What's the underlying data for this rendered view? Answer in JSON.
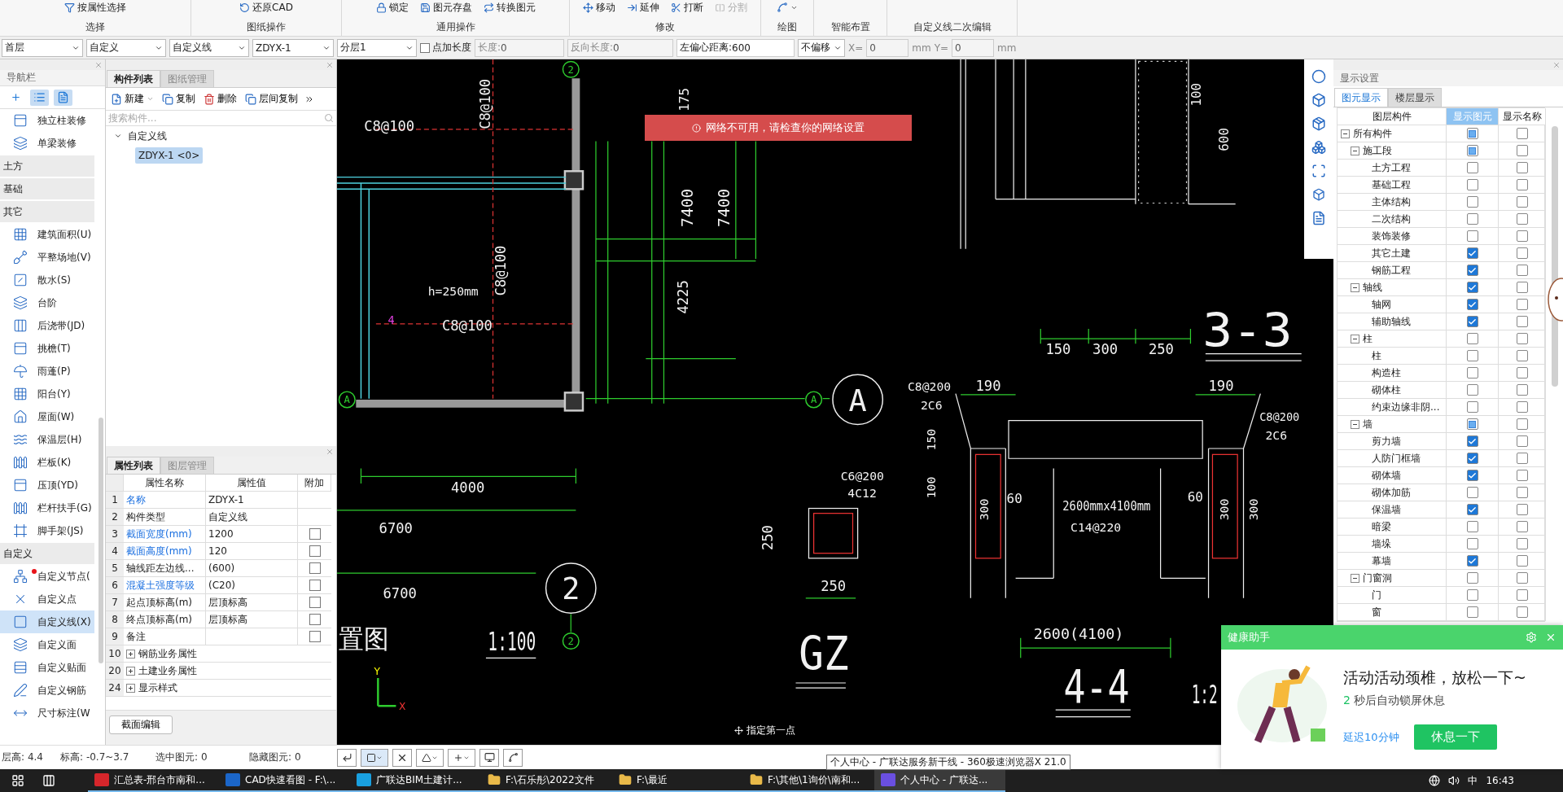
{
  "ribbon": {
    "groups": [
      {
        "label": "选择",
        "buttons": [
          {
            "label": "按属性选择",
            "disabled": false
          }
        ]
      },
      {
        "label": "图纸操作",
        "buttons": [
          {
            "label": "还原CAD",
            "disabled": false
          }
        ]
      },
      {
        "label": "通用操作",
        "buttons": [
          {
            "label": "锁定",
            "disabled": false
          },
          {
            "label": "图元存盘",
            "disabled": false
          },
          {
            "label": "转换图元",
            "disabled": false
          }
        ]
      },
      {
        "label": "修改",
        "buttons": [
          {
            "label": "移动",
            "disabled": false
          },
          {
            "label": "延伸",
            "disabled": false
          },
          {
            "label": "打断",
            "disabled": false
          },
          {
            "label": "分割",
            "disabled": true
          }
        ]
      },
      {
        "label": "绘图"
      },
      {
        "label": "智能布置"
      },
      {
        "label": "自定义线二次编辑"
      }
    ]
  },
  "toolbar": {
    "floor": "首层",
    "category": "自定义",
    "type": "自定义线",
    "component": "ZDYX-1",
    "layer": "分层1",
    "add_length": {
      "label": "点加长度",
      "checked": false
    },
    "length": {
      "label": "长度:",
      "value": "0"
    },
    "reverse_length": {
      "label": "反向长度:",
      "value": "0"
    },
    "left_offset": {
      "label": "左偏心距离:",
      "value": "600"
    },
    "offset_mode": "不偏移",
    "x": {
      "label": "X=",
      "value": "0",
      "unit": "mm"
    },
    "y": {
      "label": "Y=",
      "value": "0",
      "unit": "mm"
    }
  },
  "nav": {
    "title": "导航栏",
    "items": [
      {
        "kind": "item",
        "label": "独立柱装修",
        "selected": false,
        "alert": false
      },
      {
        "kind": "item",
        "label": "单梁装修",
        "selected": false,
        "alert": false
      },
      {
        "kind": "group",
        "label": "土方"
      },
      {
        "kind": "group",
        "label": "基础"
      },
      {
        "kind": "group",
        "label": "其它"
      },
      {
        "kind": "item",
        "label": "建筑面积(U)",
        "selected": false,
        "alert": false
      },
      {
        "kind": "item",
        "label": "平整场地(V)",
        "selected": false,
        "alert": false
      },
      {
        "kind": "item",
        "label": "散水(S)",
        "selected": false,
        "alert": false
      },
      {
        "kind": "item",
        "label": "台阶",
        "selected": false,
        "alert": false
      },
      {
        "kind": "item",
        "label": "后浇带(JD)",
        "selected": false,
        "alert": false
      },
      {
        "kind": "item",
        "label": "挑檐(T)",
        "selected": false,
        "alert": false
      },
      {
        "kind": "item",
        "label": "雨蓬(P)",
        "selected": false,
        "alert": false
      },
      {
        "kind": "item",
        "label": "阳台(Y)",
        "selected": false,
        "alert": false
      },
      {
        "kind": "item",
        "label": "屋面(W)",
        "selected": false,
        "alert": false
      },
      {
        "kind": "item",
        "label": "保温层(H)",
        "selected": false,
        "alert": false
      },
      {
        "kind": "item",
        "label": "栏板(K)",
        "selected": false,
        "alert": false
      },
      {
        "kind": "item",
        "label": "压顶(YD)",
        "selected": false,
        "alert": false
      },
      {
        "kind": "item",
        "label": "栏杆扶手(G)",
        "selected": false,
        "alert": false
      },
      {
        "kind": "item",
        "label": "脚手架(JS)",
        "selected": false,
        "alert": false
      },
      {
        "kind": "group",
        "label": "自定义"
      },
      {
        "kind": "item",
        "label": "自定义节点(",
        "selected": false,
        "alert": true
      },
      {
        "kind": "item",
        "label": "自定义点",
        "selected": false,
        "alert": false
      },
      {
        "kind": "item",
        "label": "自定义线(X)",
        "selected": true,
        "alert": false
      },
      {
        "kind": "item",
        "label": "自定义面",
        "selected": false,
        "alert": false
      },
      {
        "kind": "item",
        "label": "自定义贴面",
        "selected": false,
        "alert": false
      },
      {
        "kind": "item",
        "label": "自定义钢筋",
        "selected": false,
        "alert": false
      },
      {
        "kind": "item",
        "label": "尺寸标注(W",
        "selected": false,
        "alert": false
      }
    ]
  },
  "components_panel": {
    "tabs": [
      {
        "label": "构件列表",
        "selected": true
      },
      {
        "label": "图纸管理",
        "selected": false
      }
    ],
    "actions": [
      "新建",
      "复制",
      "删除",
      "层间复制"
    ],
    "search_placeholder": "搜索构件...",
    "tree": [
      {
        "label": "自定义线",
        "expanded": true,
        "children": [
          {
            "label": "ZDYX-1 <0>",
            "selected": true
          }
        ]
      }
    ]
  },
  "properties": {
    "tabs": [
      {
        "label": "属性列表",
        "selected": true
      },
      {
        "label": "图层管理",
        "selected": false
      }
    ],
    "columns": [
      "属性名称",
      "属性值",
      "附加"
    ],
    "rows": [
      {
        "kind": "plain",
        "num": "1",
        "name": "名称",
        "highlighted": true,
        "value": "ZDYX-1"
      },
      {
        "kind": "plain",
        "num": "2",
        "name": "构件类型",
        "highlighted": false,
        "value": "自定义线"
      },
      {
        "kind": "check",
        "num": "3",
        "name": "截面宽度(mm)",
        "highlighted": true,
        "value": "1200",
        "checked": false
      },
      {
        "kind": "check",
        "num": "4",
        "name": "截面高度(mm)",
        "highlighted": true,
        "value": "120",
        "checked": false
      },
      {
        "kind": "check",
        "num": "5",
        "name": "轴线距左边线...",
        "highlighted": false,
        "value": "(600)",
        "checked": false
      },
      {
        "kind": "check",
        "num": "6",
        "name": "混凝土强度等级",
        "highlighted": true,
        "value": "(C20)",
        "checked": false
      },
      {
        "kind": "check",
        "num": "7",
        "name": "起点顶标高(m)",
        "highlighted": false,
        "value": "层顶标高",
        "checked": false
      },
      {
        "kind": "check",
        "num": "8",
        "name": "终点顶标高(m)",
        "highlighted": false,
        "value": "层顶标高",
        "checked": false
      },
      {
        "kind": "check",
        "num": "9",
        "name": "备注",
        "highlighted": false,
        "checked": false
      },
      {
        "kind": "group",
        "num": "10",
        "name": "钢筋业务属性",
        "expanded": false
      },
      {
        "kind": "group",
        "num": "20",
        "name": "土建业务属性",
        "expanded": false
      },
      {
        "kind": "group",
        "num": "24",
        "name": "显示样式",
        "expanded": false
      }
    ],
    "button": "截面编辑"
  },
  "canvas": {
    "notice": "网络不可用，请检查你的网络设置",
    "prompt": "指定第一点",
    "labels": [
      "C8@100",
      "C8@100",
      "h=250mm",
      "C8@100",
      "4",
      "C8@100",
      "4000",
      "6700",
      "6700",
      "置图",
      "1:100",
      "175",
      "7400",
      "7400",
      "4225",
      "GZ",
      "C6@200",
      "4C12",
      "250",
      "250",
      "C8@200",
      "2C6",
      "190",
      "150",
      "100",
      "300",
      "60",
      "2600mmx4100mm",
      "C14@220",
      "2600(4100)",
      "4-4",
      "1:2",
      "190",
      "C8@200",
      "2C6",
      "60",
      "300",
      "300",
      "3-3",
      "150",
      "300",
      "250",
      "100",
      "600"
    ],
    "axis_bubbles": [
      "2",
      "A",
      "A",
      "A",
      "2",
      "2"
    ],
    "axis_triad": {
      "x": "X",
      "y": "Y"
    }
  },
  "display_settings": {
    "title": "显示设置",
    "tabs": [
      {
        "label": "图元显示",
        "selected": true
      },
      {
        "label": "楼层显示",
        "selected": false
      }
    ],
    "columns": [
      "图层构件",
      "显示图元",
      "显示名称"
    ],
    "tree": [
      {
        "label": "所有构件",
        "shown": false,
        "mixed": true,
        "show_name": false,
        "expanded": true,
        "children": [
          {
            "label": "施工段",
            "shown": false,
            "mixed": true,
            "show_name": false,
            "expanded": true,
            "children": [
              {
                "label": "土方工程",
                "shown": false,
                "mixed": false,
                "show_name": false
              },
              {
                "label": "基础工程",
                "shown": false,
                "mixed": false,
                "show_name": false
              },
              {
                "label": "主体结构",
                "shown": false,
                "mixed": false,
                "show_name": false
              },
              {
                "label": "二次结构",
                "shown": false,
                "mixed": false,
                "show_name": false
              },
              {
                "label": "装饰装修",
                "shown": false,
                "mixed": false,
                "show_name": false
              },
              {
                "label": "其它土建",
                "shown": true,
                "show_name": false
              },
              {
                "label": "钢筋工程",
                "shown": true,
                "show_name": false
              }
            ]
          },
          {
            "label": "轴线",
            "shown": true,
            "show_name": false,
            "expanded": true,
            "children": [
              {
                "label": "轴网",
                "shown": true,
                "show_name": false
              },
              {
                "label": "辅助轴线",
                "shown": true,
                "show_name": false
              }
            ]
          },
          {
            "label": "柱",
            "shown": false,
            "mixed": false,
            "show_name": false,
            "expanded": true,
            "children": [
              {
                "label": "柱",
                "shown": false,
                "mixed": false,
                "show_name": false
              },
              {
                "label": "构造柱",
                "shown": false,
                "mixed": false,
                "show_name": false
              },
              {
                "label": "砌体柱",
                "shown": false,
                "mixed": false,
                "show_name": false
              },
              {
                "label": "约束边缘非阴...",
                "shown": false,
                "mixed": false,
                "show_name": false
              }
            ]
          },
          {
            "label": "墙",
            "shown": false,
            "mixed": true,
            "show_name": false,
            "expanded": true,
            "children": [
              {
                "label": "剪力墙",
                "shown": true,
                "show_name": false
              },
              {
                "label": "人防门框墙",
                "shown": true,
                "show_name": false
              },
              {
                "label": "砌体墙",
                "shown": true,
                "show_name": false
              },
              {
                "label": "砌体加筋",
                "shown": false,
                "mixed": false,
                "show_name": false
              },
              {
                "label": "保温墙",
                "shown": true,
                "show_name": false
              },
              {
                "label": "暗梁",
                "shown": false,
                "mixed": false,
                "show_name": false
              },
              {
                "label": "墙垛",
                "shown": false,
                "mixed": false,
                "show_name": false
              },
              {
                "label": "幕墙",
                "shown": true,
                "show_name": false
              }
            ]
          },
          {
            "label": "门窗洞",
            "shown": false,
            "mixed": false,
            "show_name": false,
            "expanded": true,
            "children": [
              {
                "label": "门",
                "shown": false,
                "mixed": false,
                "show_name": false
              },
              {
                "label": "窗",
                "shown": false,
                "mixed": false,
                "show_name": false
              }
            ]
          }
        ]
      }
    ]
  },
  "status": [
    {
      "label": "层高:",
      "value": "4.4"
    },
    {
      "label": "标高:",
      "value": "-0.7~3.7"
    },
    {
      "label": "选中图元:",
      "value": "0"
    },
    {
      "label": "隐藏图元:",
      "value": "0"
    }
  ],
  "health_popup": {
    "title": "健康助手",
    "message": "活动活动颈椎，放松一下~",
    "countdown": "2",
    "countdown_text": "秒后自动锁屏休息",
    "delay_link": "延迟10分钟",
    "rest_button": "休息一下"
  },
  "tooltip": "个人中心 - 广联达服务新干线 - 360极速浏览器X 21.0",
  "taskbar": {
    "apps": [
      {
        "kind": "wps",
        "label": "汇总表-邢台市南和...",
        "active": false
      },
      {
        "kind": "cad",
        "label": "CAD快速看图 - F:\\...",
        "active": false
      },
      {
        "kind": "bim",
        "label": "广联达BIM土建计...",
        "active": false
      },
      {
        "kind": "folder",
        "label": "F:\\石乐彤\\2022文件",
        "active": false
      },
      {
        "kind": "folder",
        "label": "F:\\最近",
        "active": false
      },
      {
        "kind": "folder",
        "label": "F:\\其他\\1询价\\南和...",
        "active": false
      },
      {
        "kind": "browser",
        "label": "个人中心 - 广联达...",
        "active": true
      }
    ],
    "ime": "中",
    "time": "16:43"
  }
}
